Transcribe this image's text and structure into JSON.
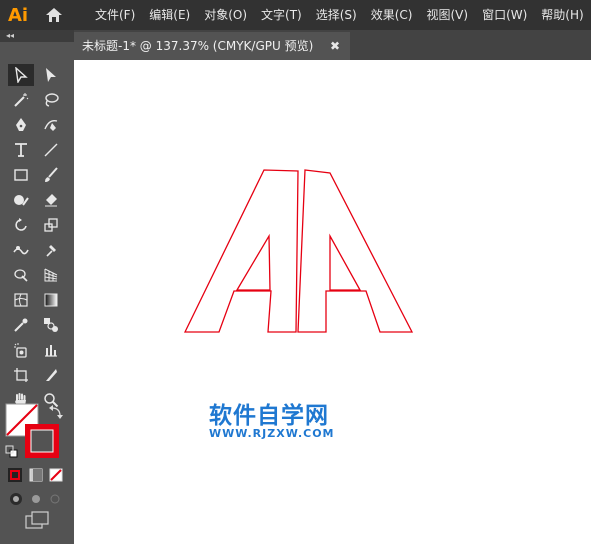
{
  "app": {
    "logo": "Ai"
  },
  "menu": [
    "文件(F)",
    "编辑(E)",
    "对象(O)",
    "文字(T)",
    "选择(S)",
    "效果(C)",
    "视图(V)",
    "窗口(W)",
    "帮助(H)"
  ],
  "panel": {
    "collapse_label": "◂◂"
  },
  "tab": {
    "title": "未标题-1* @ 137.37% (CMYK/GPU 预览)",
    "close": "✖"
  },
  "colors": {
    "stroke": "#e60012",
    "watermark": "#1f78d1",
    "accent": "#ff9a00"
  },
  "watermark": {
    "text": "软件自学网",
    "url": "WWW.RJZXW.COM"
  },
  "icons": [
    "home-icon",
    "selection-tool-icon",
    "direct-selection-tool-icon",
    "magic-wand-icon",
    "lasso-icon",
    "pen-tool-icon",
    "curvature-tool-icon",
    "type-tool-icon",
    "line-tool-icon",
    "rectangle-tool-icon",
    "paintbrush-icon",
    "shaper-tool-icon",
    "eraser-icon",
    "rotate-icon",
    "scale-icon",
    "width-tool-icon",
    "puppet-warp-icon",
    "shape-builder-icon",
    "perspective-grid-icon",
    "mesh-icon",
    "gradient-icon",
    "eyedropper-icon",
    "blend-icon",
    "symbol-sprayer-icon",
    "graph-icon",
    "artboard-icon",
    "slice-icon",
    "hand-icon",
    "zoom-icon"
  ]
}
